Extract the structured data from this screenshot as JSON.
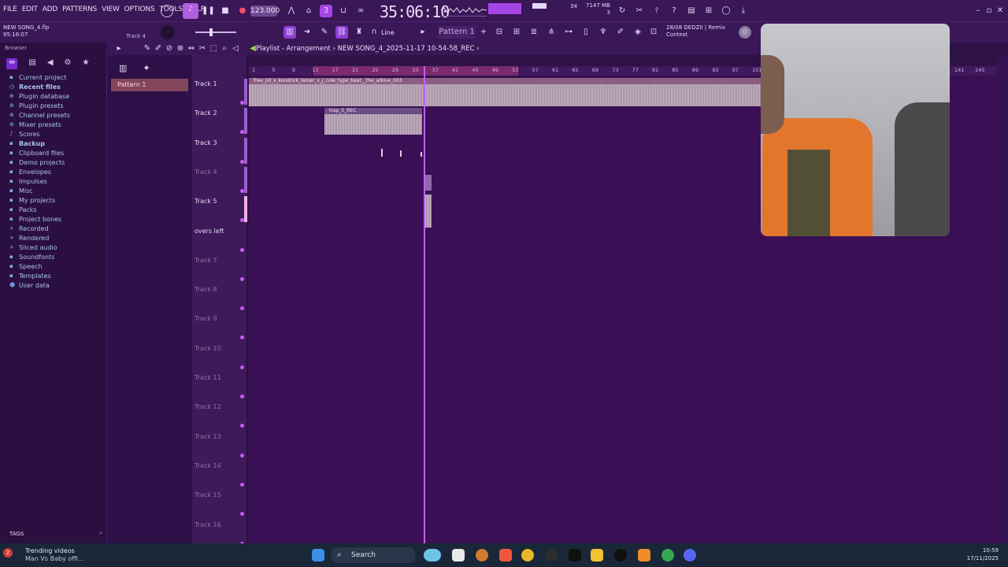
{
  "menu": [
    "FILE",
    "EDIT",
    "ADD",
    "PATTERNS",
    "VIEW",
    "OPTIONS",
    "TOOLS",
    "HELP"
  ],
  "transport": {
    "tempo": "123.000",
    "time": "35:06:10",
    "memory": "7147 MB",
    "memory_sub": "3",
    "cpu": "34"
  },
  "song": {
    "name": "NEW SONG_4.flp",
    "elapsed": "95:16:07",
    "hint": "Track 4"
  },
  "snap": "Line",
  "pattern_select": "Pattern 1",
  "news": {
    "date": "28/08",
    "title": "DEDZII | Remix",
    "subtitle": "Contest"
  },
  "browser": {
    "title": "Browser",
    "items": [
      {
        "label": "Current project",
        "icon": "folder-icon",
        "bold": false
      },
      {
        "label": "Recent files",
        "icon": "recent-icon",
        "bold": true
      },
      {
        "label": "Plugin database",
        "icon": "plugin-icon",
        "bold": false
      },
      {
        "label": "Plugin presets",
        "icon": "plugin-icon",
        "bold": false
      },
      {
        "label": "Channel presets",
        "icon": "plugin-icon",
        "bold": false
      },
      {
        "label": "Mixer presets",
        "icon": "plugin-icon",
        "bold": false
      },
      {
        "label": "Scores",
        "icon": "note-icon",
        "bold": false
      },
      {
        "label": "Backup",
        "icon": "folder-icon",
        "bold": true
      },
      {
        "label": "Clipboard files",
        "icon": "folder-icon",
        "bold": false
      },
      {
        "label": "Demo projects",
        "icon": "folder-icon",
        "bold": false
      },
      {
        "label": "Envelopes",
        "icon": "folder-icon",
        "bold": false
      },
      {
        "label": "Impulses",
        "icon": "folder-icon",
        "bold": false
      },
      {
        "label": "Misc",
        "icon": "folder-icon",
        "bold": false
      },
      {
        "label": "My projects",
        "icon": "folder-icon",
        "bold": false
      },
      {
        "label": "Packs",
        "icon": "folder-icon",
        "bold": false
      },
      {
        "label": "Project bones",
        "icon": "folder-icon",
        "bold": false
      },
      {
        "label": "Recorded",
        "icon": "plus-icon",
        "bold": false
      },
      {
        "label": "Rendered",
        "icon": "plus-icon",
        "bold": false
      },
      {
        "label": "Sliced audio",
        "icon": "plus-icon",
        "bold": false
      },
      {
        "label": "Soundfonts",
        "icon": "folder-icon",
        "bold": false
      },
      {
        "label": "Speech",
        "icon": "folder-icon",
        "bold": false
      },
      {
        "label": "Templates",
        "icon": "folder-icon",
        "bold": false
      },
      {
        "label": "User data",
        "icon": "user-icon",
        "bold": false
      }
    ],
    "tags": "TAGS"
  },
  "picker": {
    "pattern": "Pattern 1"
  },
  "playlist": {
    "title": "Playlist - Arrangement",
    "path": "NEW SONG_4_2025-11-17 10-54-58_REC",
    "tracks": [
      {
        "name": "Track 1",
        "dim": false
      },
      {
        "name": "Track 2",
        "dim": false
      },
      {
        "name": "Track 3",
        "dim": false
      },
      {
        "name": "Track 4",
        "dim": true
      },
      {
        "name": "Track 5",
        "dim": false
      },
      {
        "name": "overs left",
        "dim": false
      },
      {
        "name": "Track 7",
        "dim": true
      },
      {
        "name": "Track 8",
        "dim": true
      },
      {
        "name": "Track 9",
        "dim": true
      },
      {
        "name": "Track 10",
        "dim": true
      },
      {
        "name": "Track 11",
        "dim": true
      },
      {
        "name": "Track 12",
        "dim": true
      },
      {
        "name": "Track 13",
        "dim": true
      },
      {
        "name": "Track 14",
        "dim": true
      },
      {
        "name": "Track 15",
        "dim": true
      },
      {
        "name": "Track 16",
        "dim": true
      }
    ],
    "ruler": [
      "1",
      "5",
      "9",
      "13",
      "17",
      "21",
      "25",
      "29",
      "33",
      "37",
      "41",
      "45",
      "49",
      "53",
      "57",
      "61",
      "65",
      "69",
      "73",
      "77",
      "81",
      "85",
      "89",
      "93",
      "97",
      "101",
      "141",
      "145"
    ],
    "clips": {
      "beat": "free_jid_x_kendrick_lamar_x_j_cole_type_beat__the_arkive_003",
      "trap": "trap_5_REC"
    }
  },
  "taskbar": {
    "news_title": "Trending videos",
    "news_sub": "Man Vs Baby offi...",
    "badge": "2",
    "search": "Search",
    "time": "10:59",
    "date": "17/11/2025"
  }
}
